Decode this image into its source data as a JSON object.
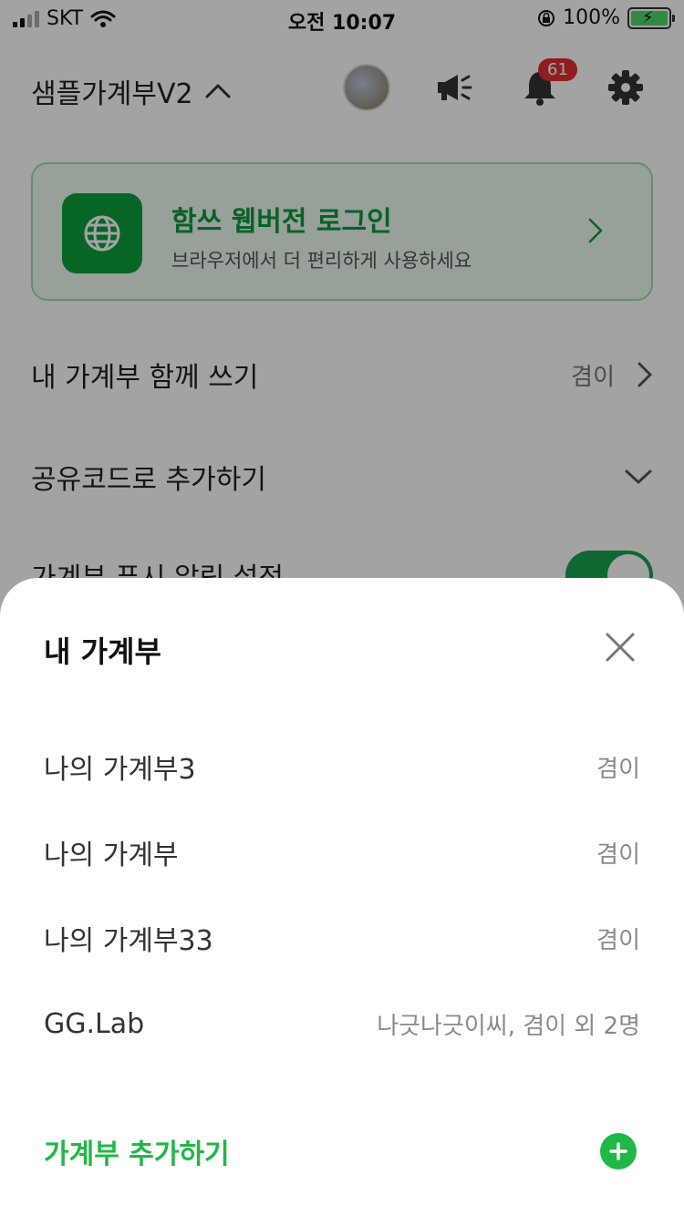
{
  "status_bar": {
    "carrier": "SKT",
    "time": "오전 10:07",
    "battery": "100%"
  },
  "header": {
    "book_title": "샘플가계부V2",
    "notification_count": "61"
  },
  "promo": {
    "title": "함쓰 웹버전 로그인",
    "subtitle": "브라우저에서 더 편리하게 사용하세요"
  },
  "settings": {
    "share": {
      "label": "내 가계부 함께 쓰기",
      "value": "겸이"
    },
    "share_code": {
      "label": "공유코드로 추가하기"
    },
    "push": {
      "label": "가계부 푸시 알림 설정"
    }
  },
  "sheet": {
    "title": "내 가계부",
    "items": [
      {
        "name": "나의 가계부3",
        "owner": "겸이"
      },
      {
        "name": "나의 가계부",
        "owner": "겸이"
      },
      {
        "name": "나의 가계부33",
        "owner": "겸이"
      },
      {
        "name": "GG.Lab",
        "owner": "나긋나긋이씨,  겸이 외 2명"
      }
    ],
    "add_label": "가계부 추가하기"
  },
  "colors": {
    "accent": "#1fb847",
    "promo_green": "#0ca03c",
    "badge": "#e03131"
  },
  "icons": [
    "signal-icon",
    "wifi-icon",
    "lock-rotation-icon",
    "battery-icon",
    "chevron-up-icon",
    "avatar",
    "megaphone-icon",
    "bell-icon",
    "gear-icon",
    "globe-icon",
    "chevron-right-icon",
    "chevron-down-icon",
    "close-icon",
    "plus-icon"
  ]
}
